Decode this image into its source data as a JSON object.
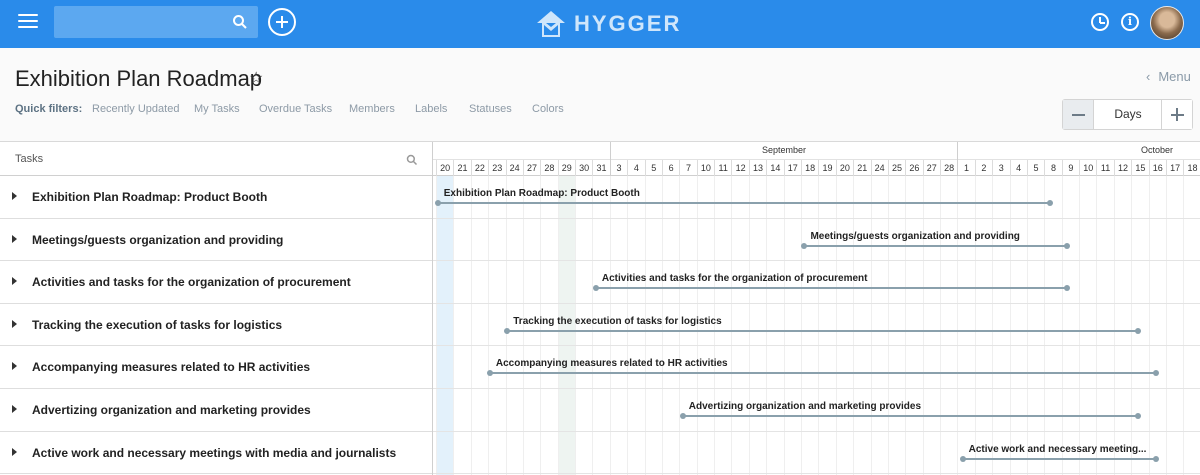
{
  "app": {
    "brand": "HYGGER",
    "search_placeholder": ""
  },
  "page": {
    "title": "Exhibition Plan Roadmap",
    "menu_label": "Menu"
  },
  "quick_filters": {
    "label": "Quick filters:",
    "items": [
      "Recently Updated",
      "My Tasks",
      "Overdue Tasks",
      "Members",
      "Labels",
      "Statuses",
      "Colors"
    ]
  },
  "zoom": {
    "label": "Days"
  },
  "tasks_panel": {
    "header": "Tasks"
  },
  "timeline": {
    "months": [
      "September",
      "October"
    ],
    "days": [
      "20",
      "21",
      "22",
      "23",
      "24",
      "27",
      "28",
      "29",
      "30",
      "31",
      "3",
      "4",
      "5",
      "6",
      "7",
      "10",
      "11",
      "12",
      "13",
      "14",
      "17",
      "18",
      "19",
      "20",
      "21",
      "24",
      "25",
      "26",
      "27",
      "28",
      "1",
      "2",
      "3",
      "4",
      "5",
      "8",
      "9",
      "10",
      "11",
      "12",
      "15",
      "16",
      "17",
      "18"
    ]
  },
  "tasks": [
    {
      "name": "Exhibition Plan Roadmap: Product Booth",
      "bar_label": "Exhibition Plan Roadmap: Product Booth"
    },
    {
      "name": "Meetings/guests organization and providing",
      "bar_label": "Meetings/guests organization and providing"
    },
    {
      "name": "Activities and tasks for the organization of procurement",
      "bar_label": "Activities and tasks for the organization of procurement"
    },
    {
      "name": "Tracking the execution of tasks for logistics",
      "bar_label": "Tracking the execution of tasks for logistics"
    },
    {
      "name": "Accompanying measures related to HR activities",
      "bar_label": "Accompanying measures related to HR activities"
    },
    {
      "name": "Advertizing organization and marketing provides",
      "bar_label": "Advertizing organization and marketing provides"
    },
    {
      "name": "Active work and necessary meetings with media and journalists",
      "bar_label": "Active work and necessary meeting..."
    }
  ],
  "colors": {
    "topbar": "#2a8bea",
    "bar": "#8aa0ac",
    "today": "#e3f1fb"
  }
}
